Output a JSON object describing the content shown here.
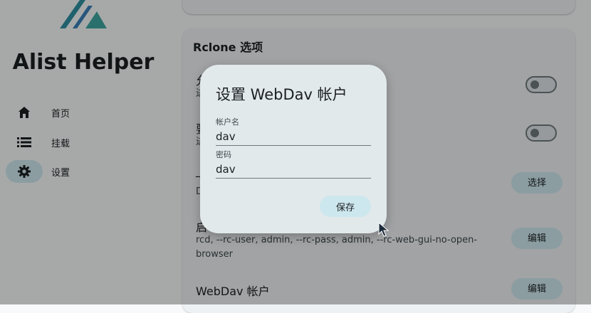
{
  "app": {
    "title": "Alist Helper"
  },
  "sidebar": {
    "items": [
      {
        "label": "首页",
        "icon": "home-icon"
      },
      {
        "label": "挂载",
        "icon": "list-icon"
      },
      {
        "label": "设置",
        "icon": "gear-icon",
        "active": true
      }
    ]
  },
  "settings": {
    "section_title": "Rclone 选项",
    "rows": [
      {
        "title": "允",
        "sub": "进",
        "control": "toggle",
        "checked": false
      },
      {
        "title": "要",
        "sub": "进",
        "control": "toggle",
        "checked": false
      },
      {
        "title": "_",
        "sub": "D",
        "control": "button",
        "button_label": "选择"
      },
      {
        "title": "启",
        "sub": "rcd, --rc-user, admin, --rc-pass, admin, --rc-web-gui-no-open-browser",
        "control": "button",
        "button_label": "编辑"
      },
      {
        "title": "WebDav 帐户",
        "sub": "",
        "control": "button",
        "button_label": "编辑"
      }
    ]
  },
  "dialog": {
    "title": "设置 WebDav 帐户",
    "username_label": "帐户名",
    "username_value": "dav",
    "password_label": "密码",
    "password_value": "dav",
    "save_label": "保存"
  },
  "colors": {
    "accent": "#cde7ee",
    "dialog_bg": "#e2e9eb",
    "logo": "#2f8fa0"
  }
}
